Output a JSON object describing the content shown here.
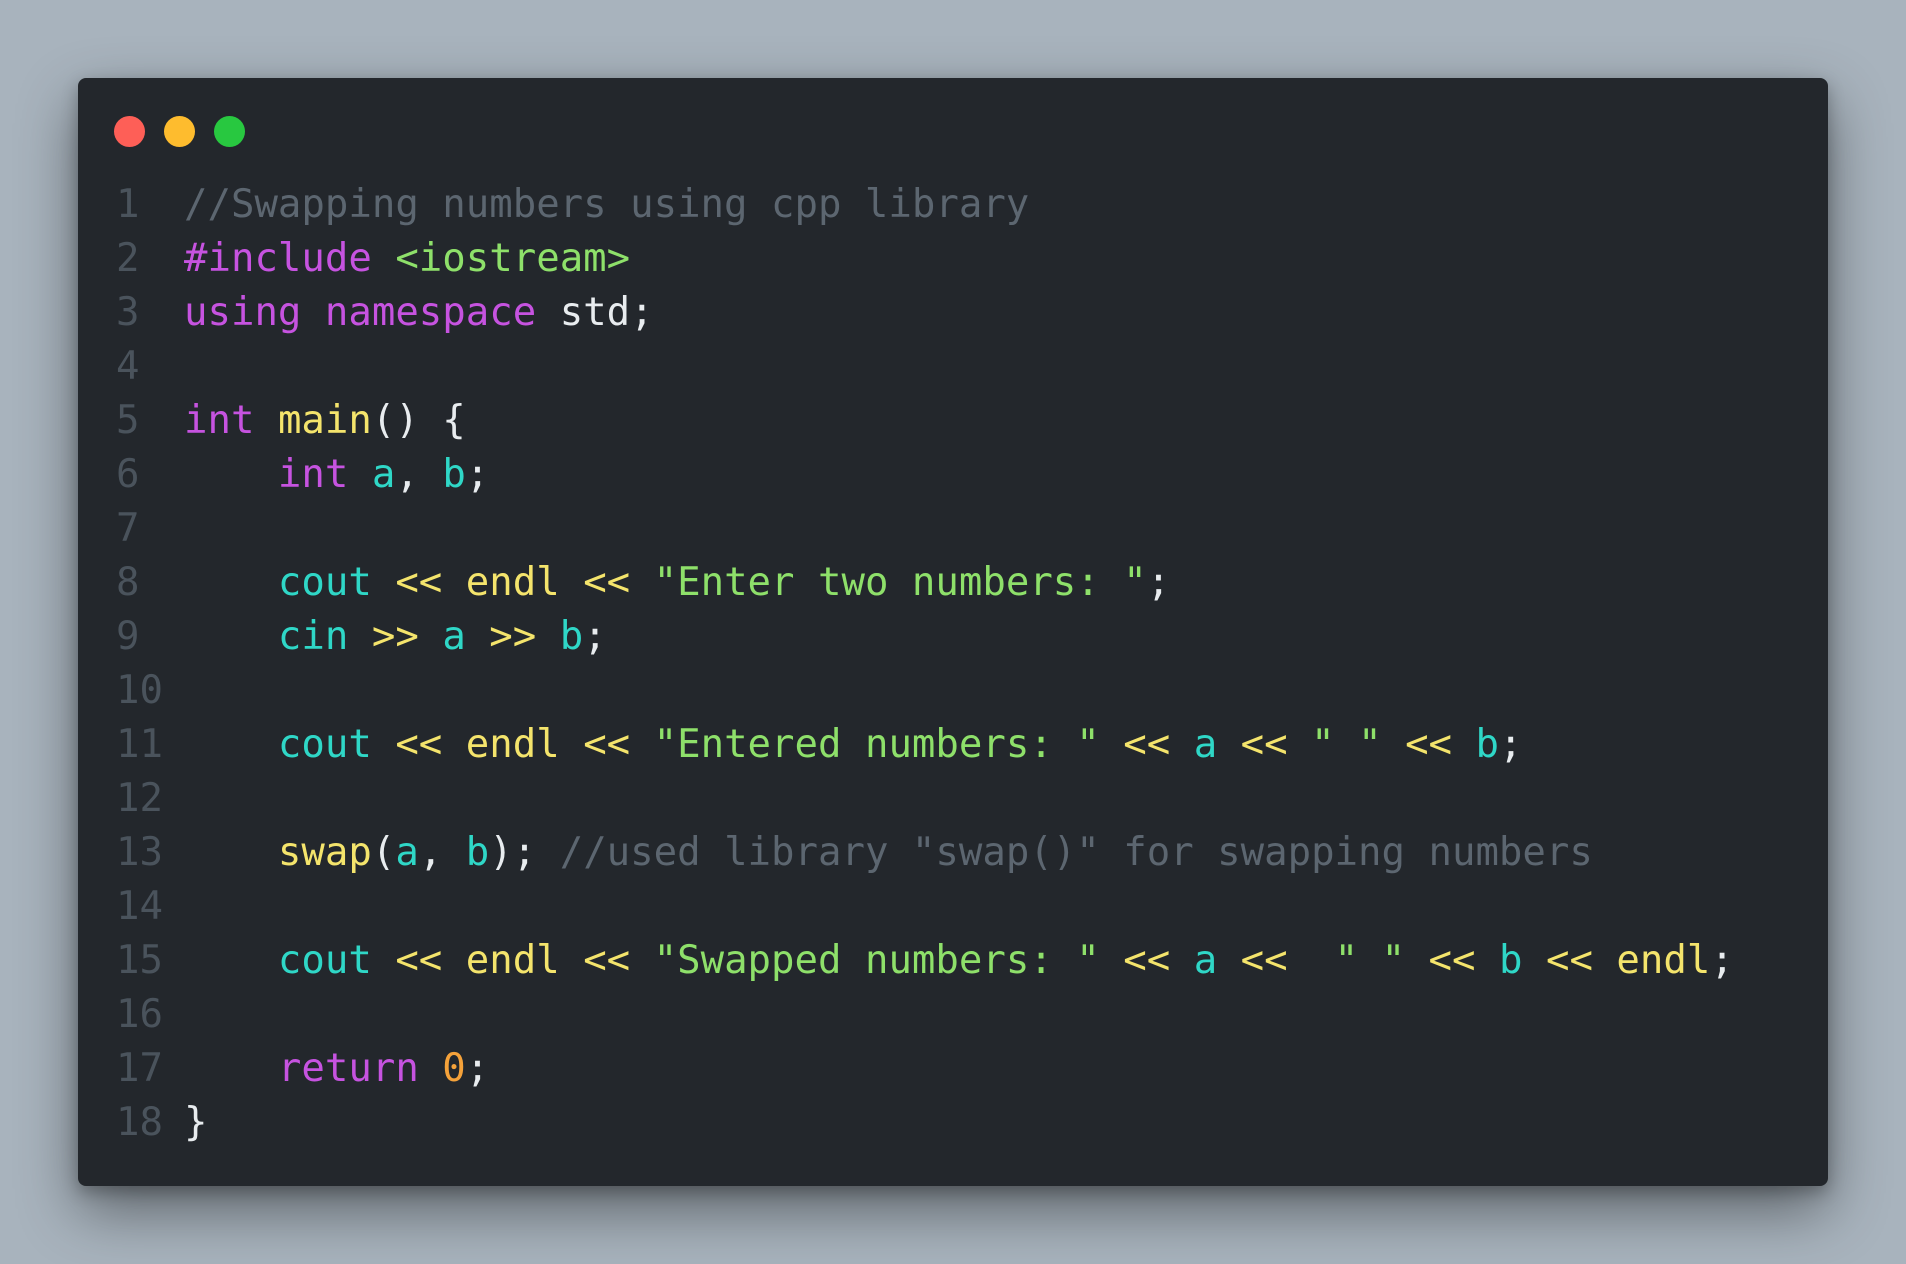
{
  "window": {
    "traffic_lights": [
      {
        "name": "close",
        "color": "#fe5f57"
      },
      {
        "name": "minimize",
        "color": "#febc2e"
      },
      {
        "name": "zoom",
        "color": "#28c840"
      }
    ]
  },
  "theme": {
    "background": "#23272c",
    "page_background": "#a8b3bd",
    "colors": {
      "comment": "#5c6670",
      "keyword": "#c653e0",
      "include": "#c653e0",
      "header": "#8ee06a",
      "plain": "#e8ecef",
      "func": "#f4e46c",
      "var": "#2fd7c7",
      "op": "#f4e46c",
      "string": "#8ee06a",
      "number": "#f5a23a",
      "punct": "#e8ecef",
      "line_number": "#4a535c"
    }
  },
  "code": {
    "language": "cpp",
    "lines": [
      {
        "n": "1",
        "tokens": [
          {
            "t": "//Swapping numbers using cpp library",
            "c": "comment"
          }
        ]
      },
      {
        "n": "2",
        "tokens": [
          {
            "t": "#include",
            "c": "include"
          },
          {
            "t": " ",
            "c": "plain"
          },
          {
            "t": "<iostream>",
            "c": "header"
          }
        ]
      },
      {
        "n": "3",
        "tokens": [
          {
            "t": "using",
            "c": "keyword"
          },
          {
            "t": " ",
            "c": "plain"
          },
          {
            "t": "namespace",
            "c": "keyword"
          },
          {
            "t": " std;",
            "c": "plain"
          }
        ]
      },
      {
        "n": "4",
        "tokens": []
      },
      {
        "n": "5",
        "tokens": [
          {
            "t": "int",
            "c": "keyword"
          },
          {
            "t": " ",
            "c": "plain"
          },
          {
            "t": "main",
            "c": "func"
          },
          {
            "t": "() {",
            "c": "plain"
          }
        ]
      },
      {
        "n": "6",
        "tokens": [
          {
            "t": "    ",
            "c": "plain"
          },
          {
            "t": "int",
            "c": "keyword"
          },
          {
            "t": " ",
            "c": "plain"
          },
          {
            "t": "a",
            "c": "var"
          },
          {
            "t": ", ",
            "c": "plain"
          },
          {
            "t": "b",
            "c": "var"
          },
          {
            "t": ";",
            "c": "plain"
          }
        ]
      },
      {
        "n": "7",
        "tokens": []
      },
      {
        "n": "8",
        "tokens": [
          {
            "t": "    ",
            "c": "plain"
          },
          {
            "t": "cout",
            "c": "var"
          },
          {
            "t": " ",
            "c": "plain"
          },
          {
            "t": "<<",
            "c": "op"
          },
          {
            "t": " ",
            "c": "plain"
          },
          {
            "t": "endl",
            "c": "func"
          },
          {
            "t": " ",
            "c": "plain"
          },
          {
            "t": "<<",
            "c": "op"
          },
          {
            "t": " ",
            "c": "plain"
          },
          {
            "t": "\"Enter two numbers: \"",
            "c": "string"
          },
          {
            "t": ";",
            "c": "plain"
          }
        ]
      },
      {
        "n": "9",
        "tokens": [
          {
            "t": "    ",
            "c": "plain"
          },
          {
            "t": "cin",
            "c": "var"
          },
          {
            "t": " ",
            "c": "plain"
          },
          {
            "t": ">>",
            "c": "op"
          },
          {
            "t": " ",
            "c": "plain"
          },
          {
            "t": "a",
            "c": "var"
          },
          {
            "t": " ",
            "c": "plain"
          },
          {
            "t": ">>",
            "c": "op"
          },
          {
            "t": " ",
            "c": "plain"
          },
          {
            "t": "b",
            "c": "var"
          },
          {
            "t": ";",
            "c": "plain"
          }
        ]
      },
      {
        "n": "10",
        "tokens": []
      },
      {
        "n": "11",
        "tokens": [
          {
            "t": "    ",
            "c": "plain"
          },
          {
            "t": "cout",
            "c": "var"
          },
          {
            "t": " ",
            "c": "plain"
          },
          {
            "t": "<<",
            "c": "op"
          },
          {
            "t": " ",
            "c": "plain"
          },
          {
            "t": "endl",
            "c": "func"
          },
          {
            "t": " ",
            "c": "plain"
          },
          {
            "t": "<<",
            "c": "op"
          },
          {
            "t": " ",
            "c": "plain"
          },
          {
            "t": "\"Entered numbers: \"",
            "c": "string"
          },
          {
            "t": " ",
            "c": "plain"
          },
          {
            "t": "<<",
            "c": "op"
          },
          {
            "t": " ",
            "c": "plain"
          },
          {
            "t": "a",
            "c": "var"
          },
          {
            "t": " ",
            "c": "plain"
          },
          {
            "t": "<<",
            "c": "op"
          },
          {
            "t": " ",
            "c": "plain"
          },
          {
            "t": "\" \"",
            "c": "string"
          },
          {
            "t": " ",
            "c": "plain"
          },
          {
            "t": "<<",
            "c": "op"
          },
          {
            "t": " ",
            "c": "plain"
          },
          {
            "t": "b",
            "c": "var"
          },
          {
            "t": ";",
            "c": "plain"
          }
        ]
      },
      {
        "n": "12",
        "tokens": []
      },
      {
        "n": "13",
        "tokens": [
          {
            "t": "    ",
            "c": "plain"
          },
          {
            "t": "swap",
            "c": "func"
          },
          {
            "t": "(",
            "c": "plain"
          },
          {
            "t": "a",
            "c": "var"
          },
          {
            "t": ", ",
            "c": "plain"
          },
          {
            "t": "b",
            "c": "var"
          },
          {
            "t": "); ",
            "c": "plain"
          },
          {
            "t": "//used library \"swap()\" for swapping numbers",
            "c": "comment"
          }
        ]
      },
      {
        "n": "14",
        "tokens": []
      },
      {
        "n": "15",
        "tokens": [
          {
            "t": "    ",
            "c": "plain"
          },
          {
            "t": "cout",
            "c": "var"
          },
          {
            "t": " ",
            "c": "plain"
          },
          {
            "t": "<<",
            "c": "op"
          },
          {
            "t": " ",
            "c": "plain"
          },
          {
            "t": "endl",
            "c": "func"
          },
          {
            "t": " ",
            "c": "plain"
          },
          {
            "t": "<<",
            "c": "op"
          },
          {
            "t": " ",
            "c": "plain"
          },
          {
            "t": "\"Swapped numbers: \"",
            "c": "string"
          },
          {
            "t": " ",
            "c": "plain"
          },
          {
            "t": "<<",
            "c": "op"
          },
          {
            "t": " ",
            "c": "plain"
          },
          {
            "t": "a",
            "c": "var"
          },
          {
            "t": " ",
            "c": "plain"
          },
          {
            "t": "<<",
            "c": "op"
          },
          {
            "t": "  ",
            "c": "plain"
          },
          {
            "t": "\" \"",
            "c": "string"
          },
          {
            "t": " ",
            "c": "plain"
          },
          {
            "t": "<<",
            "c": "op"
          },
          {
            "t": " ",
            "c": "plain"
          },
          {
            "t": "b",
            "c": "var"
          },
          {
            "t": " ",
            "c": "plain"
          },
          {
            "t": "<<",
            "c": "op"
          },
          {
            "t": " ",
            "c": "plain"
          },
          {
            "t": "endl",
            "c": "func"
          },
          {
            "t": ";",
            "c": "plain"
          }
        ]
      },
      {
        "n": "16",
        "tokens": []
      },
      {
        "n": "17",
        "tokens": [
          {
            "t": "    ",
            "c": "plain"
          },
          {
            "t": "return",
            "c": "keyword"
          },
          {
            "t": " ",
            "c": "plain"
          },
          {
            "t": "0",
            "c": "number"
          },
          {
            "t": ";",
            "c": "plain"
          }
        ]
      },
      {
        "n": "18",
        "tokens": [
          {
            "t": "}",
            "c": "plain"
          }
        ]
      }
    ]
  }
}
